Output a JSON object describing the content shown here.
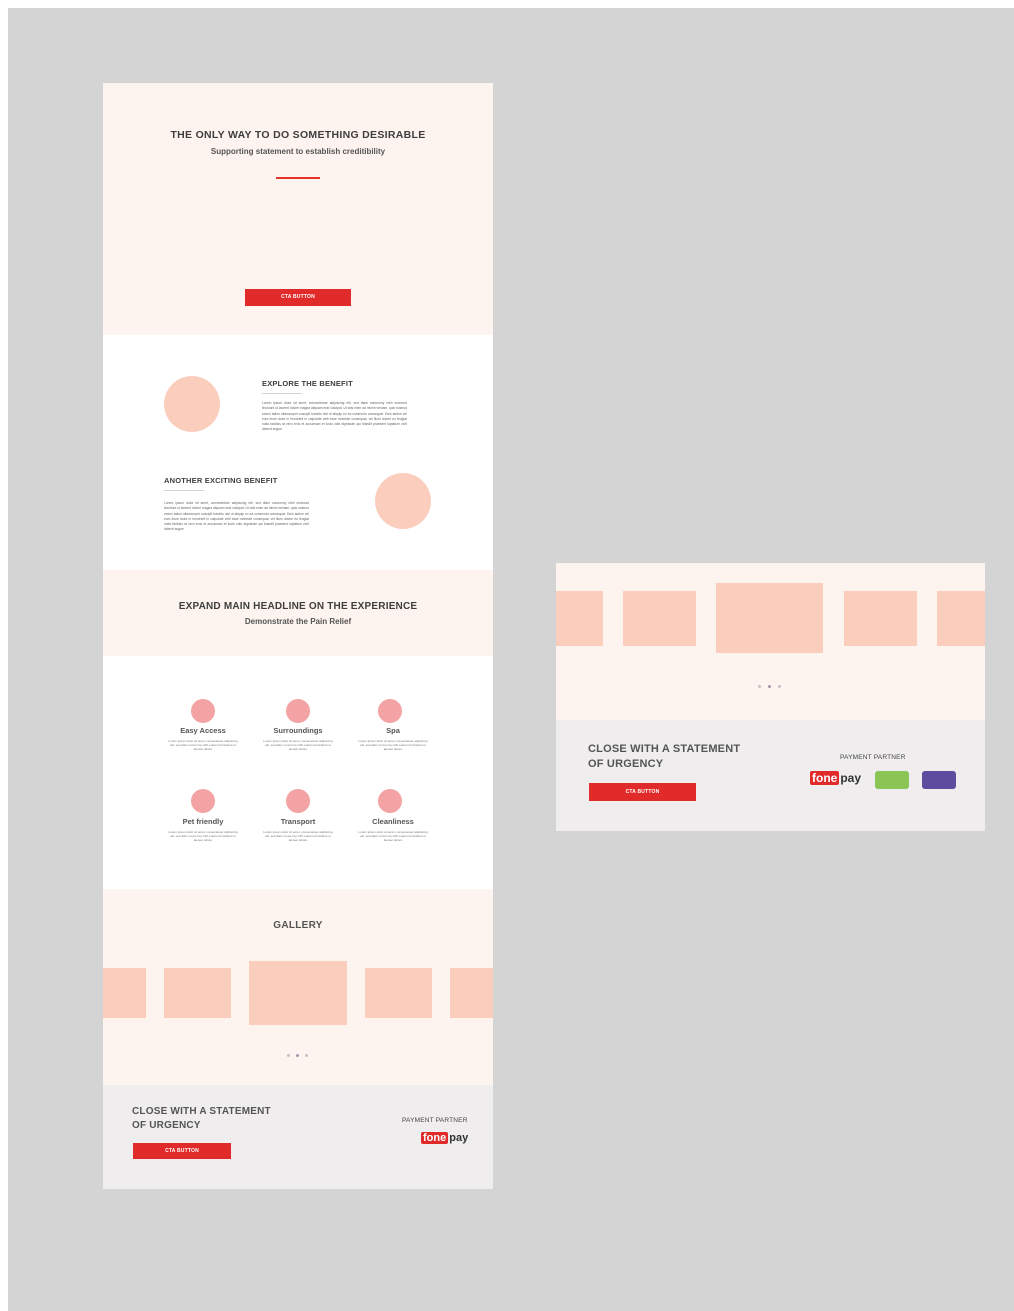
{
  "hero": {
    "headline": "THE ONLY WAY TO DO SOMETHING DESIRABLE",
    "subtitle": "Supporting statement to establish creditibility",
    "cta_label": "CTA BUTTON"
  },
  "benefits": {
    "first_title": "EXPLORE THE BENEFIT",
    "first_text": "Lorem ipsum dolor sit amet, consectetuer adipiscing elit, sed diam nonummy nibh euismod tincidunt ut laoreet dolore magna aliquam erat volutpat. Ut wisi enim ad minim veniam, quis nostrud exerci tation ullamcorper suscipit lobortis nisl ut aliquip ex ea commodo consequat. Duis autem vel eum iriure dolor in hendrerit in vulputate velit esse molestie consequat, vel illum dolore eu feugiat nulla facilisis at vero eros et accumsan et iusto odio dignissim qui blandit praesent luptatum zzril delenit augue.",
    "second_title": "ANOTHER EXCITING BENEFIT",
    "second_text": "Lorem ipsum dolor sit amet, consectetuer adipiscing elit, sed diam nonummy nibh euismod tincidunt ut laoreet dolore magna aliquam erat volutpat. Ut wisi enim ad minim veniam, quis nostrud exerci tation ullamcorper suscipit lobortis nisl ut aliquip ex ea commodo consequat. Duis autem vel eum iriure dolor in hendrerit in vulputate velit esse molestie consequat, vel illum dolore eu feugiat nulla facilisis at vero eros et accumsan et iusto odio dignissim qui blandit praesent luptatum zzril delenit augue."
  },
  "experience": {
    "headline": "EXPAND MAIN HEADLINE ON THE EXPERIENCE",
    "subtitle": "Demonstrate the Pain Relief"
  },
  "features": [
    {
      "label": "Easy Access",
      "text": "Lorem ipsum dolor sit amet, consectetuer adipiscing elit, sed diam nonummy nibh euismod tincidunt ut laoreet dolore"
    },
    {
      "label": "Surroundings",
      "text": "Lorem ipsum dolor sit amet, consectetuer adipiscing elit, sed diam nonummy nibh euismod tincidunt ut laoreet dolore"
    },
    {
      "label": "Spa",
      "text": "Lorem ipsum dolor sit amet, consectetuer adipiscing elit, sed diam nonummy nibh euismod tincidunt ut laoreet dolore"
    },
    {
      "label": "Pet friendly",
      "text": "Lorem ipsum dolor sit amet, consectetuer adipiscing elit, sed diam nonummy nibh euismod tincidunt ut laoreet dolore"
    },
    {
      "label": "Transport",
      "text": "Lorem ipsum dolor sit amet, consectetuer adipiscing elit, sed diam nonummy nibh euismod tincidunt ut laoreet dolore"
    },
    {
      "label": "Cleanliness",
      "text": "Lorem ipsum dolor sit amet, consectetuer adipiscing elit, sed diam nonummy nibh euismod tincidunt ut laoreet dolore"
    }
  ],
  "gallery": {
    "title": "GALLERY"
  },
  "closing": {
    "line1": "CLOSE WITH A STATEMENT",
    "line2": "OF URGENCY",
    "cta_label": "CTA BUTTON",
    "partner_label": "PAYMENT PARTNER",
    "fonepay_a": "fone",
    "fonepay_b": "pay"
  },
  "colors": {
    "canvas": "#d4d4d4",
    "peach": "#fdf3ef",
    "accent_red": "#e12a2a",
    "placeholder": "#fbcdbd",
    "feature_dot": "#f3a3a3",
    "partner_green": "#8cc455",
    "partner_purple": "#5e4c9e"
  }
}
